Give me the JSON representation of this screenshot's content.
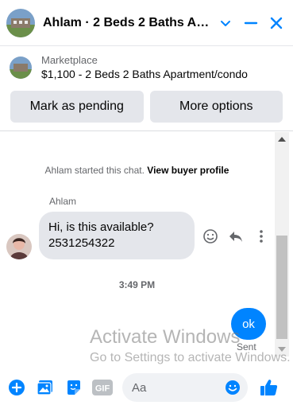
{
  "header": {
    "title": "Ahlam · 2 Beds 2 Baths Apartment/condo",
    "icons": [
      "chevron-down-icon",
      "minimize-icon",
      "close-icon"
    ],
    "accent": "#0084ff"
  },
  "marketplace": {
    "label": "Marketplace",
    "listing": "$1,100 - 2 Beds 2 Baths Apartment/condo",
    "mark_pending_label": "Mark as pending",
    "more_options_label": "More options"
  },
  "conversation": {
    "started_prefix": "Ahlam started this chat.",
    "view_profile_label": "View buyer profile",
    "incoming": {
      "sender": "Ahlam",
      "line1": "Hi, is this available?",
      "line2": "2531254322"
    },
    "time": "3:49 PM",
    "outgoing": {
      "text": "ok",
      "status": "Sent"
    }
  },
  "watermark": {
    "title": "Activate Windows",
    "subtitle": "Go to Settings to activate Windows."
  },
  "composer": {
    "placeholder": "Aa",
    "icons": [
      "plus-icon",
      "photo-icon",
      "sticker-icon",
      "gif-icon",
      "emoji-icon",
      "like-icon"
    ],
    "gif_label": "GIF"
  }
}
